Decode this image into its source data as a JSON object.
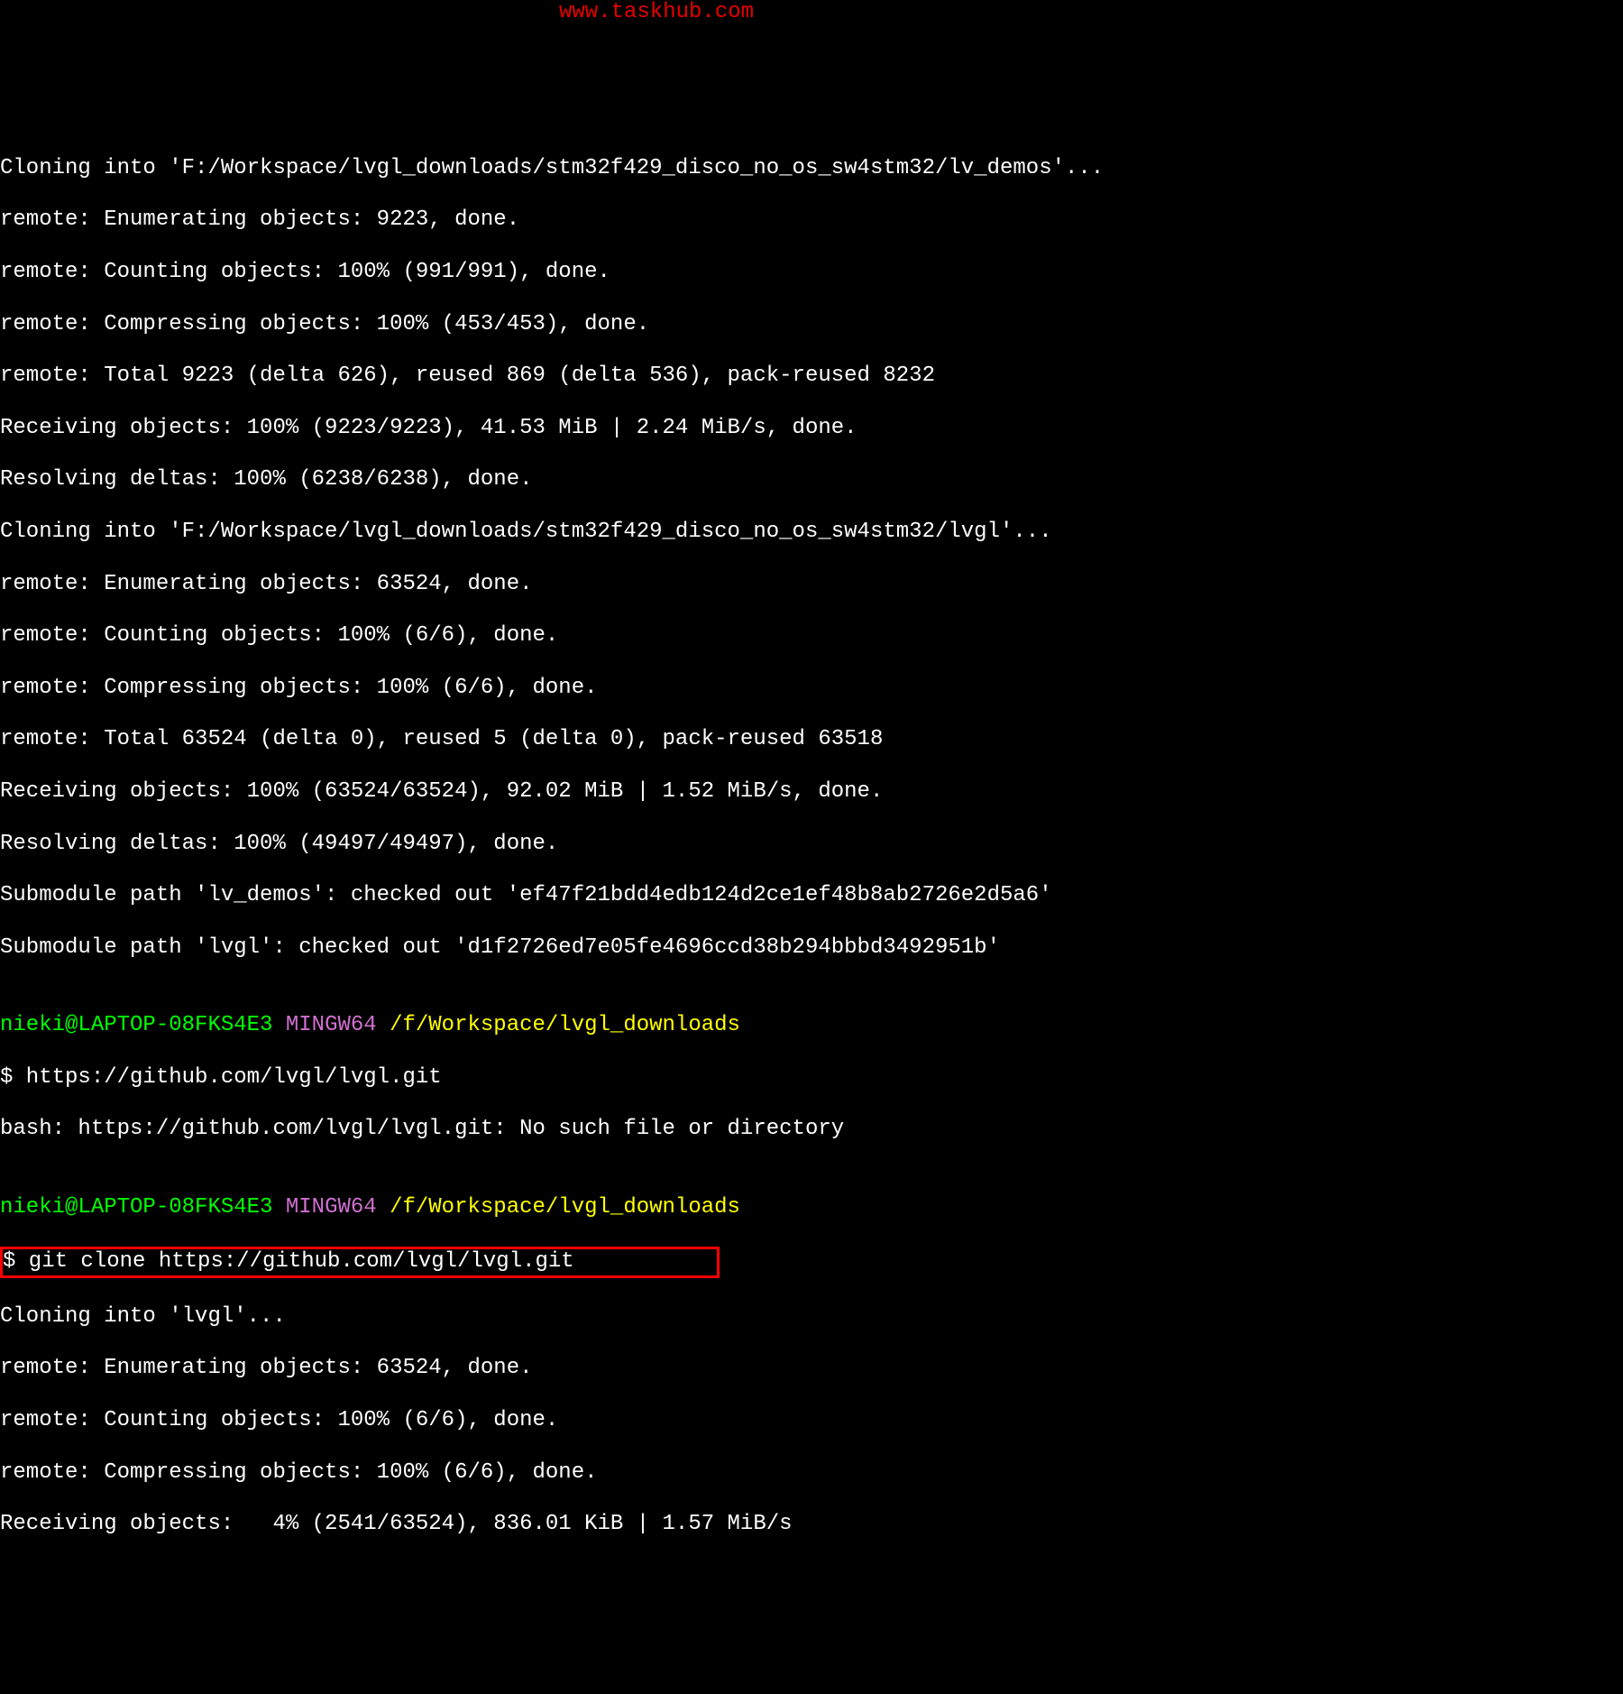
{
  "watermark": "www.taskhub.com",
  "lines": {
    "l1": "Cloning into 'F:/Workspace/lvgl_downloads/stm32f429_disco_no_os_sw4stm32/lv_demos'...",
    "l2": "remote: Enumerating objects: 9223, done.",
    "l3": "remote: Counting objects: 100% (991/991), done.",
    "l4": "remote: Compressing objects: 100% (453/453), done.",
    "l5": "remote: Total 9223 (delta 626), reused 869 (delta 536), pack-reused 8232",
    "l6": "Receiving objects: 100% (9223/9223), 41.53 MiB | 2.24 MiB/s, done.",
    "l7": "Resolving deltas: 100% (6238/6238), done.",
    "l8": "Cloning into 'F:/Workspace/lvgl_downloads/stm32f429_disco_no_os_sw4stm32/lvgl'...",
    "l9": "remote: Enumerating objects: 63524, done.",
    "l10": "remote: Counting objects: 100% (6/6), done.",
    "l11": "remote: Compressing objects: 100% (6/6), done.",
    "l12": "remote: Total 63524 (delta 0), reused 5 (delta 0), pack-reused 63518",
    "l13": "Receiving objects: 100% (63524/63524), 92.02 MiB | 1.52 MiB/s, done.",
    "l14": "Resolving deltas: 100% (49497/49497), done.",
    "l15": "Submodule path 'lv_demos': checked out 'ef47f21bdd4edb124d2ce1ef48b8ab2726e2d5a6'",
    "l16": "Submodule path 'lvgl': checked out 'd1f2726ed7e05fe4696ccd38b294bbbd3492951b'",
    "l17": "",
    "l18_user": "nieki@LAPTOP-08FKS4E3",
    "l18_env": " MINGW64",
    "l18_path": " /f/Workspace/lvgl_downloads",
    "l19": "$ https://github.com/lvgl/lvgl.git",
    "l20": "bash: https://github.com/lvgl/lvgl.git: No such file or directory",
    "l21": "",
    "l22_user": "nieki@LAPTOP-08FKS4E3",
    "l22_env": " MINGW64",
    "l22_path": " /f/Workspace/lvgl_downloads",
    "l23": "$ git clone https://github.com/lvgl/lvgl.git",
    "l24": "Cloning into 'lvgl'...",
    "l25": "remote: Enumerating objects: 63524, done.",
    "l26": "remote: Counting objects: 100% (6/6), done.",
    "l27": "remote: Compressing objects: 100% (6/6), done.",
    "l28": "Receiving objects:   4% (2541/63524), 836.01 KiB | 1.57 MiB/s"
  }
}
